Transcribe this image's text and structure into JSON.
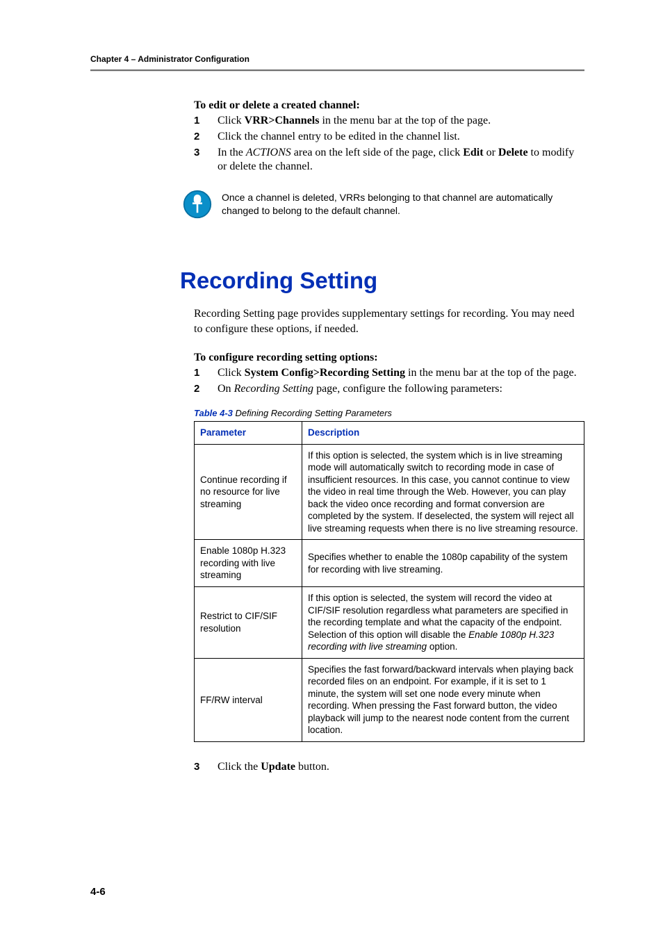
{
  "header": {
    "running": "Chapter 4 – Administrator Configuration"
  },
  "procedure1": {
    "title": "To edit or delete a created channel:",
    "steps": [
      {
        "n": "1",
        "pre": "Click ",
        "bold": "VRR>Channels",
        "post": " in the menu bar at the top of the page."
      },
      {
        "n": "2",
        "text": "Click the channel entry to be edited in the channel list."
      },
      {
        "n": "3",
        "pre": "In the ",
        "italic": "ACTIONS",
        "mid": " area on the left side of the page, click ",
        "bold1": "Edit",
        "mid2": " or ",
        "bold2": "Delete",
        "post": " to modify or delete the channel."
      }
    ]
  },
  "note": {
    "text": "Once a channel is deleted, VRRs belonging to that channel are automatically changed to belong to the default channel.",
    "icon": "pushpin-icon"
  },
  "section": {
    "title": "Recording Setting",
    "intro": "Recording Setting page provides supplementary settings for recording. You may need to configure these options, if needed."
  },
  "procedure2": {
    "title": "To configure recording setting options:",
    "step1": {
      "n": "1",
      "pre": "Click ",
      "bold": "System Config>Recording Setting",
      "post": " in the menu bar at the top of the page."
    },
    "step2": {
      "n": "2",
      "pre": "On ",
      "italic": "Recording Setting",
      "post": " page, configure the following parameters:"
    },
    "step3": {
      "n": "3",
      "pre": "Click the ",
      "bold": "Update",
      "post": " button."
    }
  },
  "table": {
    "caption_num": "Table 4-3",
    "caption_text": " Defining Recording Setting Parameters",
    "head": {
      "col1": "Parameter",
      "col2": "Description"
    },
    "rows": [
      {
        "param": "Continue recording if no resource for live streaming",
        "desc": "If this option is selected, the system which is in live streaming mode will automatically switch to recording mode in case of insufficient resources. In this case, you cannot continue to view the video in real time through the Web. However, you can play back the video once recording and format conversion are completed by the system. If deselected, the system will reject all live streaming requests when there is no live streaming resource."
      },
      {
        "param": "Enable 1080p H.323 recording with live streaming",
        "desc": "Specifies whether to enable the 1080p capability of the system for recording with live streaming."
      },
      {
        "param": "Restrict to CIF/SIF resolution",
        "desc_pre": "If this option is selected, the system will record the video at CIF/SIF resolution regardless what parameters are specified in the recording template and what the capacity of the endpoint. Selection of this option will disable the ",
        "desc_italic": "Enable 1080p H.323 recording with live streaming",
        "desc_post": " option."
      },
      {
        "param": "FF/RW interval",
        "desc": "Specifies the fast forward/backward intervals when playing back recorded files on an endpoint. For example, if it is set to 1 minute, the system will set one node every minute when recording. When pressing the Fast forward button, the video playback will jump to the nearest node content from the current location."
      }
    ]
  },
  "footer": {
    "pagenum": "4-6"
  }
}
